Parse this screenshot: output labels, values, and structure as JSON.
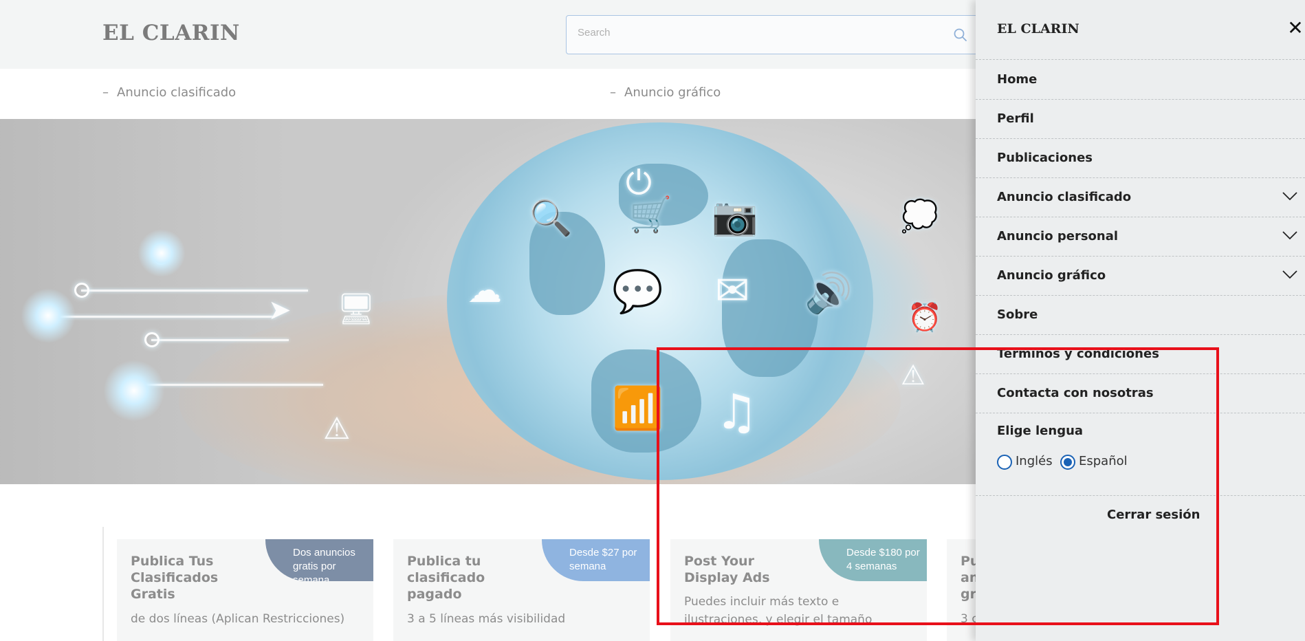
{
  "header": {
    "logo": "EL CLARIN",
    "search_placeholder": "Search"
  },
  "subnav": {
    "items": [
      {
        "label": "Anuncio clasificado"
      },
      {
        "label": "Anuncio gráfico"
      }
    ]
  },
  "cards": [
    {
      "title": "Publica Tus Clasificados Gratis",
      "badge": "Dos anuncios gratis por semana",
      "badge_color": "#7d8ea6",
      "desc": "de dos líneas (Aplican Restricciones)"
    },
    {
      "title": "Publica tu clasificado pagado",
      "badge": "Desde $27 por semana",
      "badge_color": "#8fb4e0",
      "desc": "3 a 5 líneas más visibilidad"
    },
    {
      "title": "Post Your Display Ads",
      "badge": "Desde $180 por 4 semanas",
      "badge_color": "#88b8be",
      "desc": "Puedes incluir más texto e ilustraciones, y elegir el tamaño"
    },
    {
      "title": "Pu an gr",
      "desc": "3 c"
    }
  ],
  "drawer": {
    "logo": "EL CLARIN",
    "close_icon": "close-icon",
    "items": [
      {
        "label": "Home"
      },
      {
        "label": "Perfil"
      },
      {
        "label": "Publicaciones"
      },
      {
        "label": "Anuncio clasificado",
        "expandable": true
      },
      {
        "label": "Anuncio personal",
        "expandable": true
      },
      {
        "label": "Anuncio gráfico",
        "expandable": true
      },
      {
        "label": "Sobre"
      },
      {
        "label": "Terminos y condiciones"
      },
      {
        "label": "Contacta con nosotras"
      }
    ],
    "language": {
      "title": "Elige lengua",
      "options": [
        {
          "label": "Inglés",
          "selected": false
        },
        {
          "label": "Español",
          "selected": true
        }
      ]
    },
    "logout_label": "Cerrar sesión"
  },
  "colors": {
    "accent": "#1a62b5",
    "highlight": "#e8101a",
    "drawer_bg": "#eceeef"
  }
}
